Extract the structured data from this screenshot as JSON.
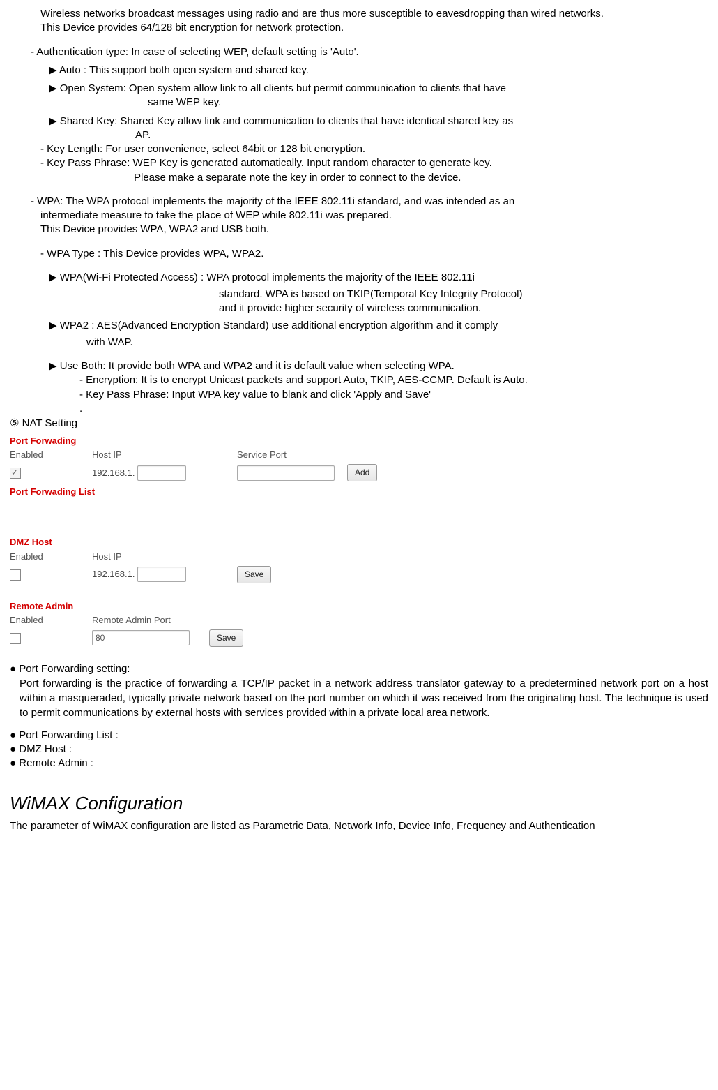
{
  "intro": {
    "l1": "Wireless networks broadcast messages using radio and are thus more susceptible to eavesdropping than wired networks.",
    "l2": "This Device provides 64/128 bit encryption for network protection."
  },
  "auth": {
    "head": "- Authentication type: In case of selecting WEP, default setting is 'Auto'.",
    "auto": "Auto : This support both open system and shared key.",
    "open1": "Open System: Open system allow link to all clients but permit communication to clients that have",
    "open2": "same WEP key.",
    "shared1": "Shared Key: Shared Key allow link and communication to clients that have identical shared key as",
    "shared2": "AP.",
    "keylen": "- Key Length: For user convenience, select 64bit or 128 bit encryption.",
    "kpp1": "- Key Pass Phrase: WEP Key is generated automatically. Input random character to generate key.",
    "kpp2": "Please make a separate note the key in order to connect to the device."
  },
  "wpa": {
    "l1": "- WPA: The WPA protocol implements the majority of the IEEE 802.11i standard, and was intended as an",
    "l2": "intermediate measure to take the place of WEP while 802.11i was prepared.",
    "l3": "This Device provides WPA, WPA2 and USB both.",
    "type": "- WPA Type : This Device provides WPA, WPA2.",
    "wpa1": "WPA(Wi-Fi Protected Access) : WPA protocol implements the majority of the IEEE 802.11i",
    "wpa_c1": "standard.    WPA is based on TKIP(Temporal Key Integrity Protocol)",
    "wpa_c2": "and it provide higher security of wireless communication.",
    "wpa2_1": "WPA2 : AES(Advanced Encryption Standard) use additional encryption algorithm and it comply",
    "wpa2_2": "with WAP.",
    "useboth": "Use Both: It provide both WPA and WPA2 and it is default value when selecting WPA.",
    "enc": "- Encryption: It is to encrypt Unicast packets and support Auto, TKIP, AES-CCMP. Default is Auto.",
    "kpp": "- Key Pass Phrase: Input WPA key value to blank and click 'Apply and Save'",
    "dot": "."
  },
  "nat": {
    "title": "⑤ NAT Setting",
    "pf_title": "Port Forwading",
    "pf_list_title": "Port Forwading List",
    "dmz_title": "DMZ Host",
    "ra_title": "Remote Admin",
    "col_enabled": "Enabled",
    "col_hostip": "Host IP",
    "col_srvport": "Service Port",
    "col_raport": "Remote Admin Port",
    "prefix": "192.168.1.",
    "ra_value": "80",
    "btn_add": "Add",
    "btn_save": "Save"
  },
  "pf": {
    "title": "Port Forwarding setting:",
    "body": "Port forwarding is the practice of forwarding a TCP/IP packet in a network address translator gateway to a predetermined network port on a host within a masqueraded, typically private network based on the port number on which it was received from the originating host. The technique is used to permit communications by external hosts with services provided within a private local area network.",
    "list": "Port Forwarding List :",
    "dmz": "DMZ Host :",
    "ra": "Remote Admin :"
  },
  "wimax": {
    "title": "WiMAX Configuration",
    "body": "The parameter of WiMAX configuration are listed as Parametric Data, Network Info, Device Info, Frequency and Authentication"
  }
}
